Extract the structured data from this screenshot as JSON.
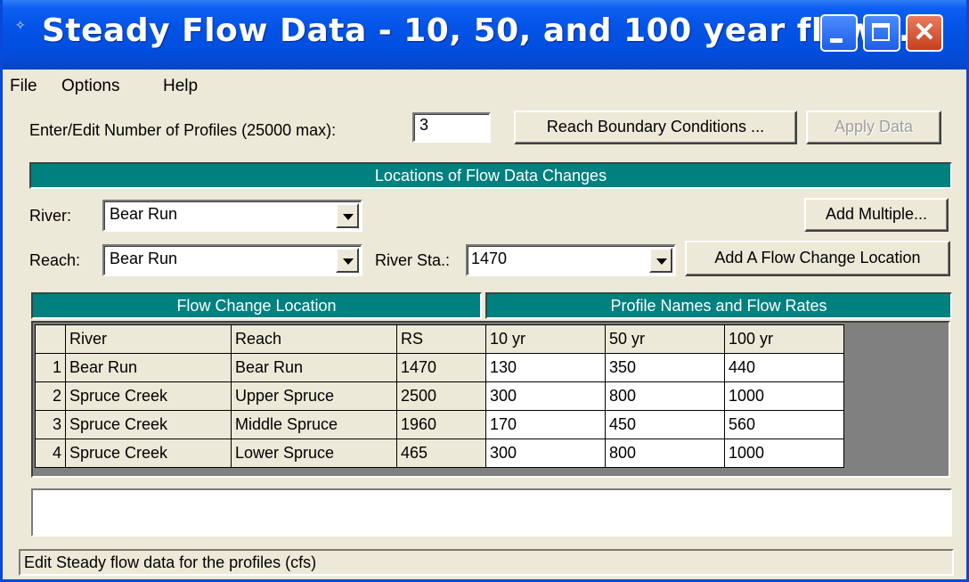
{
  "window": {
    "title": "Steady Flow Data - 10, 50, and 100 year flow..."
  },
  "menu": [
    {
      "label": "File"
    },
    {
      "label": "Options"
    },
    {
      "label": "Help"
    }
  ],
  "profiles": {
    "label": "Enter/Edit Number of Profiles (25000 max):",
    "value": "3"
  },
  "buttons": {
    "reach_bc": "Reach Boundary Conditions ...",
    "apply": "Apply Data",
    "add_multiple": "Add Multiple...",
    "add_flow_change": "Add A Flow Change Location"
  },
  "locations_header": "Locations of Flow Data Changes",
  "river": {
    "label": "River:",
    "value": "Bear Run"
  },
  "reach": {
    "label": "Reach:",
    "value": "Bear Run"
  },
  "river_sta": {
    "label": "River Sta.:",
    "value": "1470"
  },
  "grid": {
    "left_header": "Flow Change Location",
    "right_header": "Profile Names and Flow Rates",
    "columns": [
      "River",
      "Reach",
      "RS",
      "10 yr",
      "50 yr",
      "100 yr"
    ],
    "rows": [
      {
        "num": "1",
        "river": "Bear Run",
        "reach": "Bear Run",
        "rs": "1470",
        "f10": "130",
        "f50": "350",
        "f100": "440"
      },
      {
        "num": "2",
        "river": "Spruce Creek",
        "reach": "Upper Spruce",
        "rs": "2500",
        "f10": "300",
        "f50": "800",
        "f100": "1000"
      },
      {
        "num": "3",
        "river": "Spruce Creek",
        "reach": "Middle Spruce",
        "rs": "1960",
        "f10": "170",
        "f50": "450",
        "f100": "560"
      },
      {
        "num": "4",
        "river": "Spruce Creek",
        "reach": "Lower Spruce",
        "rs": "465",
        "f10": "300",
        "f50": "800",
        "f100": "1000"
      }
    ]
  },
  "status": "Edit Steady flow data for the profiles (cfs)",
  "colors": {
    "titlebar": "#0353e6",
    "teal_header": "#00807f",
    "window_bg": "#ece9d8"
  }
}
